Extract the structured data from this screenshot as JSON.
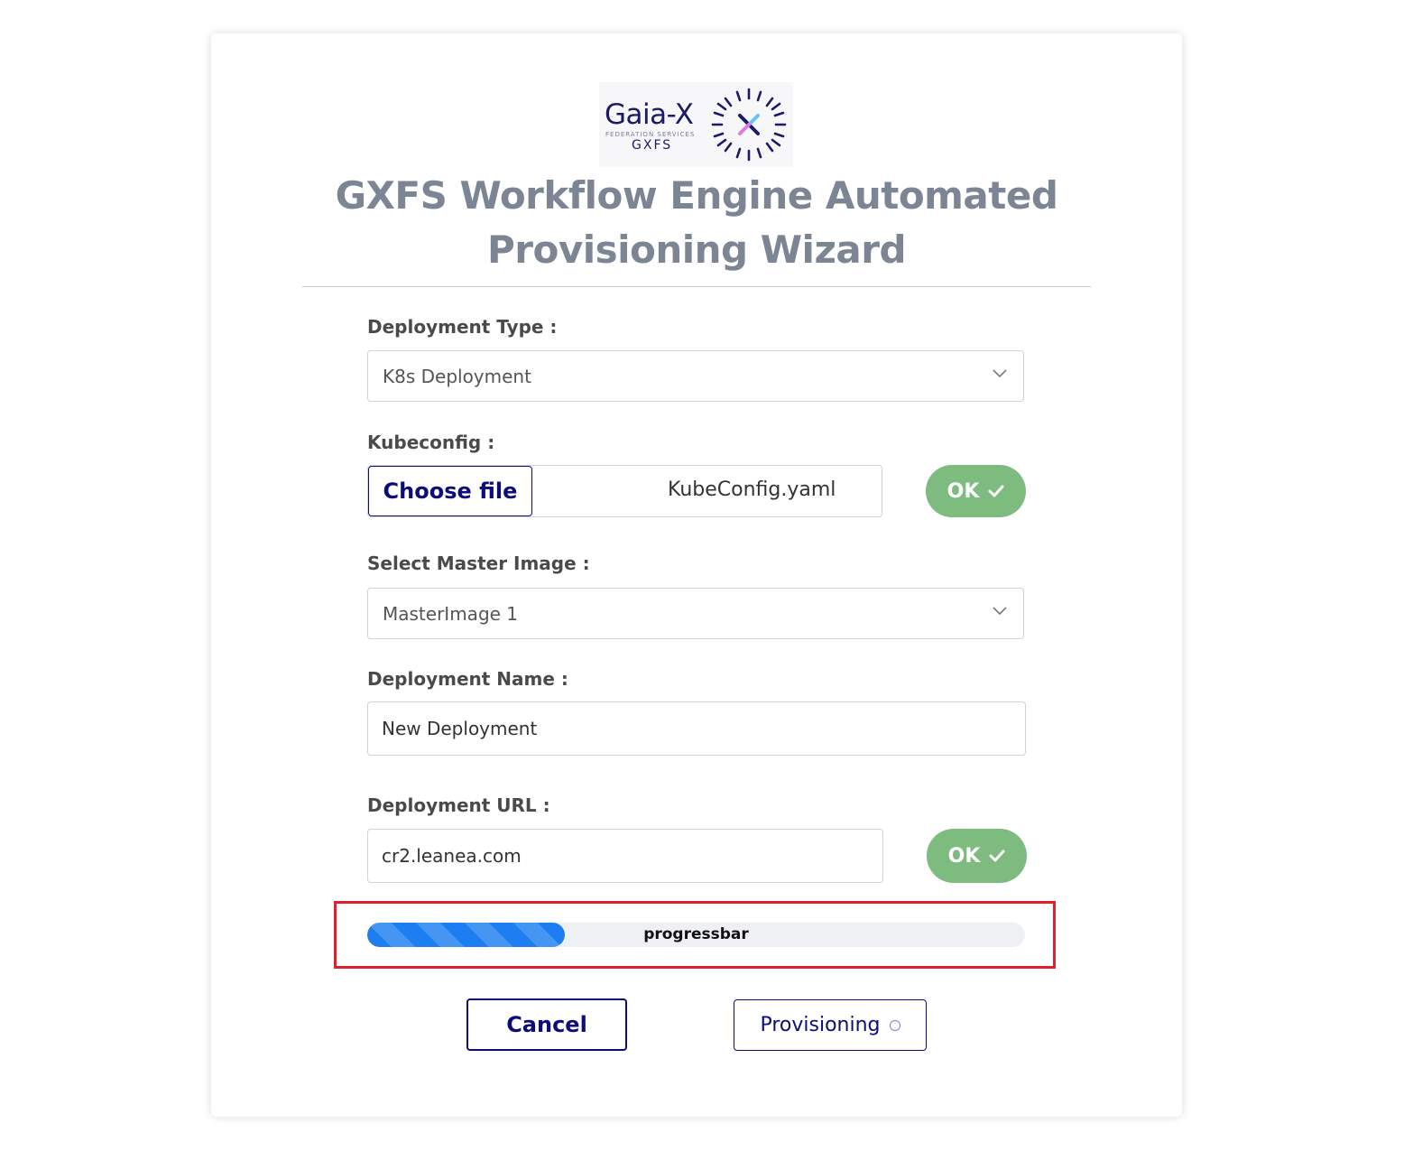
{
  "logo": {
    "wordmark": "Gaia-X",
    "subtitle": "FEDERATION SERVICES",
    "short": "GXFS"
  },
  "title": "GXFS Workflow Engine Automated Provisioning Wizard",
  "form": {
    "deployment_type": {
      "label": "Deployment Type :",
      "value": "K8s Deployment"
    },
    "kubeconfig": {
      "label": "Kubeconfig :",
      "button_label": "Choose file",
      "file_name": "KubeConfig.yaml",
      "ok_label": "OK"
    },
    "master_image": {
      "label": "Select Master Image :",
      "value": "MasterImage 1"
    },
    "deployment_name": {
      "label": "Deployment Name :",
      "value": "New Deployment"
    },
    "deployment_url": {
      "label": "Deployment URL :",
      "value": "cr2.leanea.com",
      "ok_label": "OK"
    }
  },
  "progress": {
    "label": "progressbar",
    "percent": 30
  },
  "actions": {
    "cancel_label": "Cancel",
    "provision_label": "Provisioning"
  },
  "colors": {
    "accent": "#0d0d7a",
    "ok": "#7dbb7f",
    "progress": "#1c7ef0",
    "highlight": "#e0202c"
  }
}
